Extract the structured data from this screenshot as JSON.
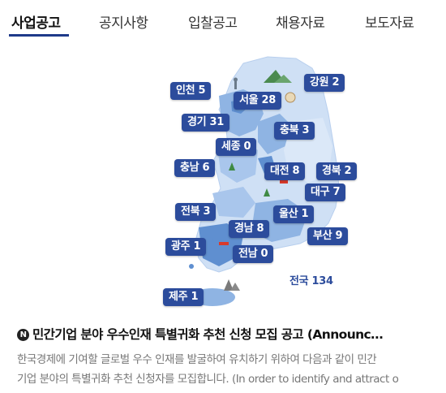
{
  "tabs": [
    {
      "label": "사업공고",
      "active": true
    },
    {
      "label": "공지사항",
      "active": false
    },
    {
      "label": "입찰공고",
      "active": false
    },
    {
      "label": "채용자료",
      "active": false
    },
    {
      "label": "보도자료",
      "active": false
    }
  ],
  "regions": {
    "incheon": "인천 5",
    "seoul": "서울 28",
    "gangwon": "강원 2",
    "gyeonggi": "경기 31",
    "chungbuk": "충북 3",
    "sejong": "세종 0",
    "chungnam": "충남 6",
    "daejeon": "대전 8",
    "gyeongbuk": "경북 2",
    "daegu": "대구 7",
    "jeonbuk": "전북 3",
    "ulsan": "울산 1",
    "gyeongnam": "경남 8",
    "busan": "부산 9",
    "gwangju": "광주 1",
    "jeonnam": "전남 0",
    "jeju": "제주 1",
    "total": "전국 134"
  },
  "article": {
    "badge": "N",
    "title": "민간기업 분야 우수인재 특별귀화 추천 신청 모집 공고 (Announc…",
    "body_line1": "한국경제에 기여할 글로벌 우수 인재를 발굴하여 유치하기 위하여 다음과 같이 민간",
    "body_line2": "기업 분야의 특별귀화 추천 신청자를 모집합니다. (In order to identify and attract o"
  },
  "colors": {
    "accent": "#1e3a8a",
    "pill": "#2c4c9c",
    "map_light": "#cfe0f5",
    "map_mid": "#8fb4e3",
    "map_dark": "#5f8fd0"
  },
  "icons": [
    "new-badge-icon",
    "mountain-icon",
    "tower-icon",
    "tree-icon",
    "bridge-icon",
    "rock-icon"
  ]
}
